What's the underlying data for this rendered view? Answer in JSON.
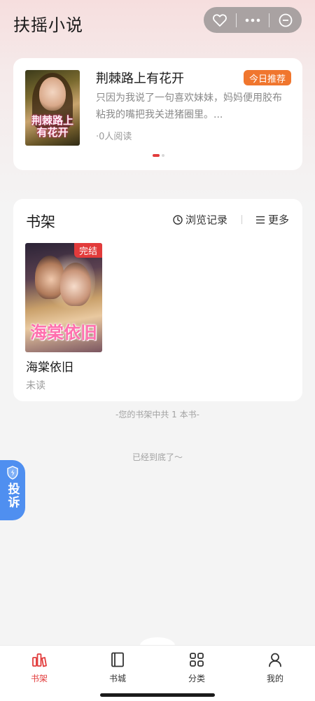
{
  "app": {
    "title": "扶摇小说"
  },
  "capsule": {
    "icons": [
      "heart-icon",
      "more-dots-icon",
      "minus-circle-icon"
    ]
  },
  "recommend": {
    "badge": "今日推荐",
    "title": "荆棘路上有花开",
    "cover_title": "荆棘路上有花开",
    "desc": "只因为我说了一句喜欢妹妹，妈妈便用胶布粘我的嘴把我关进猪圈里。...",
    "readers": "·0人阅读",
    "carousel": {
      "count": 2,
      "active_index": 0
    }
  },
  "shelf": {
    "title": "书架",
    "history_label": "浏览记录",
    "more_label": "更多",
    "books": [
      {
        "name": "海棠依旧",
        "status": "未读",
        "badge": "完结",
        "cover_title": "海棠依旧"
      }
    ],
    "count_text": "-您的书架中共 1 本书-"
  },
  "end_text": "已经到底了～",
  "complaint": {
    "label": "投诉"
  },
  "tabbar": {
    "active": "书架",
    "items": [
      {
        "label": "书架",
        "icon": "bookshelf-icon"
      },
      {
        "label": "书城",
        "icon": "book-icon"
      },
      {
        "label": "分类",
        "icon": "grid-icon"
      },
      {
        "label": "我的",
        "icon": "user-icon"
      }
    ]
  },
  "colors": {
    "accent": "#e23c3c",
    "badge_orange": "#f0762e",
    "complaint_blue": "#4f8ff0"
  }
}
